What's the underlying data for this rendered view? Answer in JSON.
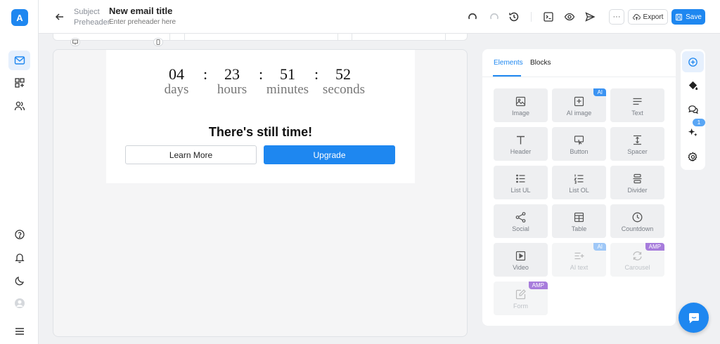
{
  "app": {
    "logo_letter": "A"
  },
  "header": {
    "subject_label": "Subject",
    "subject_value": "New email title",
    "preheader_label": "Preheader",
    "preheader_placeholder": "Enter preheader here",
    "more_label": "···",
    "export_label": "Export",
    "save_label": "Save"
  },
  "email": {
    "countdown": [
      {
        "value": "04",
        "unit": "days"
      },
      {
        "value": "23",
        "unit": "hours"
      },
      {
        "value": "51",
        "unit": "minutes"
      },
      {
        "value": "52",
        "unit": "seconds"
      }
    ],
    "colon": ":",
    "headline": "There's still time!",
    "secondary_button": "Learn More",
    "primary_button": "Upgrade"
  },
  "panel": {
    "tabs": [
      {
        "label": "Elements",
        "active": true
      },
      {
        "label": "Blocks",
        "active": false
      }
    ],
    "elements": [
      {
        "label": "Image",
        "icon": "image-icon"
      },
      {
        "label": "AI image",
        "icon": "ai-image-icon",
        "badge": "AI"
      },
      {
        "label": "Text",
        "icon": "text-icon"
      },
      {
        "label": "Header",
        "icon": "header-icon"
      },
      {
        "label": "Button",
        "icon": "button-icon"
      },
      {
        "label": "Spacer",
        "icon": "spacer-icon"
      },
      {
        "label": "List UL",
        "icon": "list-ul-icon"
      },
      {
        "label": "List OL",
        "icon": "list-ol-icon"
      },
      {
        "label": "Divider",
        "icon": "divider-icon"
      },
      {
        "label": "Social",
        "icon": "share-icon"
      },
      {
        "label": "Table",
        "icon": "table-icon"
      },
      {
        "label": "Countdown",
        "icon": "clock-icon"
      },
      {
        "label": "Video",
        "icon": "video-icon"
      },
      {
        "label": "AI text",
        "icon": "ai-text-icon",
        "badge": "AI",
        "disabled": true
      },
      {
        "label": "Carousel",
        "icon": "carousel-icon",
        "badge": "AMP",
        "disabled": true
      },
      {
        "label": "Form",
        "icon": "form-icon",
        "badge": "AMP",
        "disabled": true
      }
    ]
  },
  "tools": {
    "ai_badge_count": "1"
  },
  "colors": {
    "accent": "#1e87f0",
    "amp_badge": "#a77cdc",
    "ai_badge": "#3b93f2"
  }
}
